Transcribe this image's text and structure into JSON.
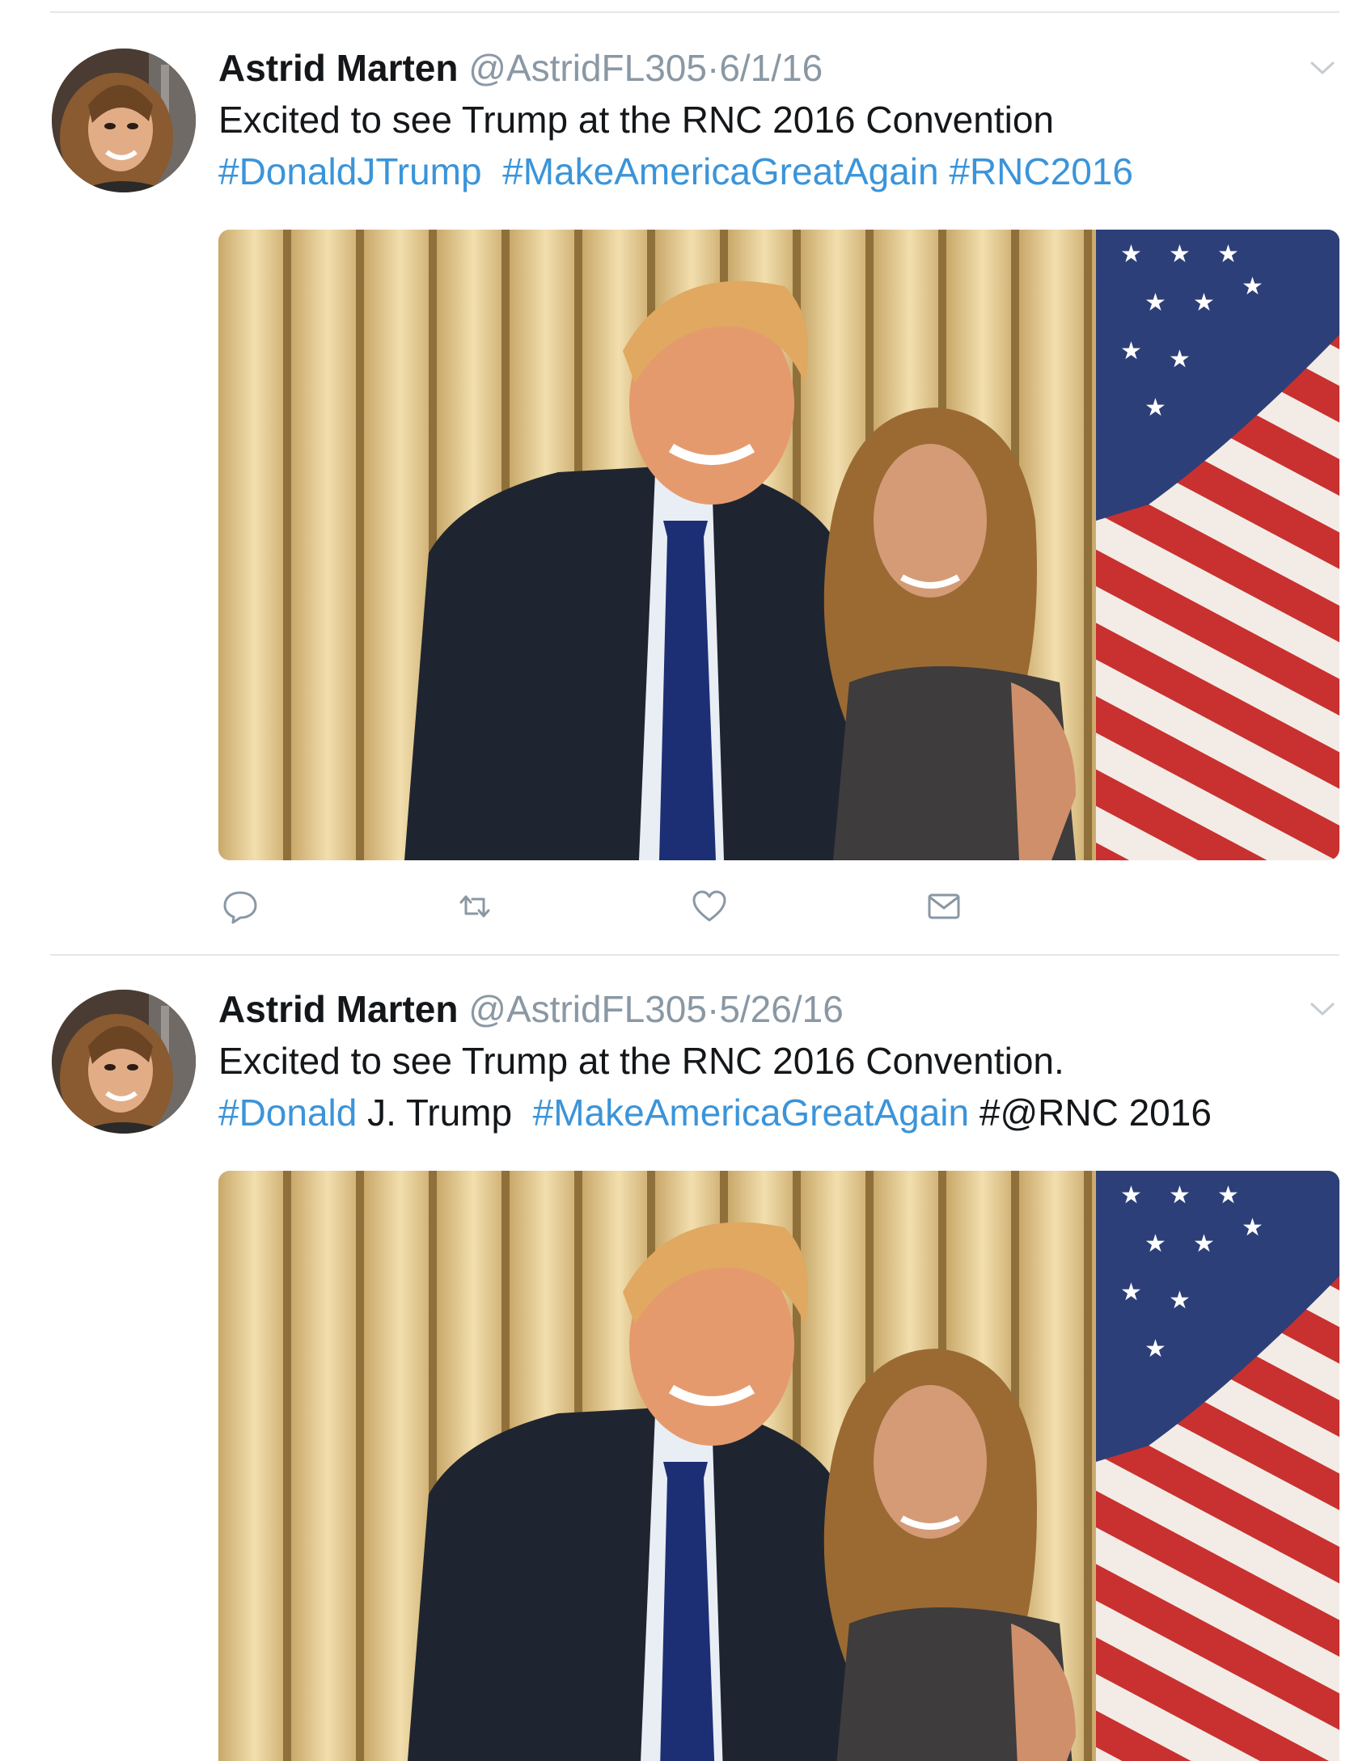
{
  "tweets": [
    {
      "author_name": "Astrid Marten",
      "handle": "@AstridFL305",
      "separator": "·",
      "date": "6/1/16",
      "text": "Excited to see Trump at the RNC 2016 Convention",
      "tags_line": [
        {
          "text": "#DonaldJTrump",
          "kind": "hashtag"
        },
        {
          "text": "  ",
          "kind": "plain"
        },
        {
          "text": "#MakeAmericaGreatAgain",
          "kind": "hashtag"
        },
        {
          "text": " ",
          "kind": "plain"
        },
        {
          "text": "#RNC2016",
          "kind": "hashtag"
        }
      ],
      "image_alt": "Photo of Donald Trump posing with a woman in front of a gold curtain and an American flag",
      "actions": [
        "reply-icon",
        "retweet-icon",
        "like-icon",
        "direct-message-icon"
      ]
    },
    {
      "author_name": "Astrid Marten",
      "handle": "@AstridFL305",
      "separator": "·",
      "date": "5/26/16",
      "text": "Excited to see Trump at the RNC 2016 Convention.",
      "tags_line": [
        {
          "text": "#Donald",
          "kind": "hashtag"
        },
        {
          "text": " J. Trump  ",
          "kind": "plain"
        },
        {
          "text": "#MakeAmericaGreatAgain",
          "kind": "hashtag"
        },
        {
          "text": " #@RNC 2016",
          "kind": "plain"
        }
      ],
      "image_alt": "Same photo of Donald Trump posing with a woman in front of a gold curtain and an American flag",
      "actions": []
    }
  ],
  "colors": {
    "hashtag": "#3b94d9",
    "meta_gray": "#8a98a4",
    "divider": "#e3e7ea",
    "text": "#14171a"
  }
}
